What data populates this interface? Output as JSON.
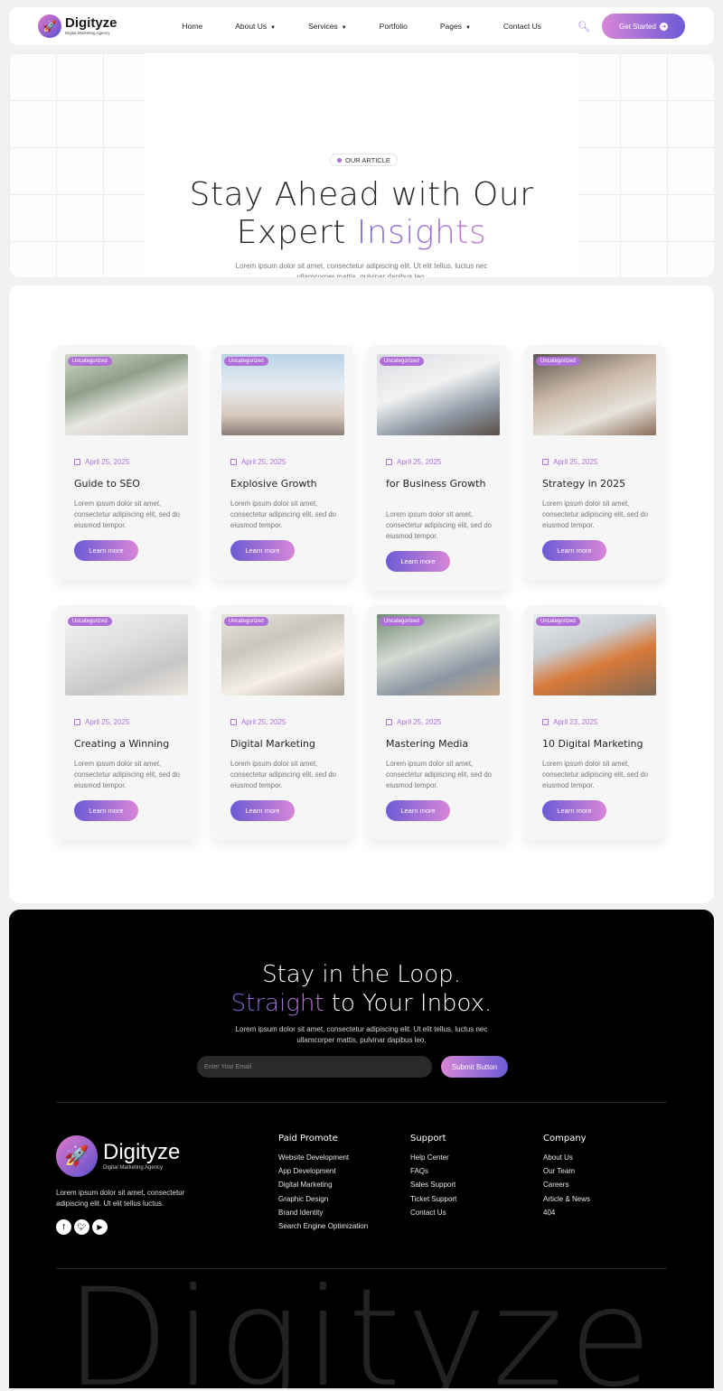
{
  "header": {
    "logo": {
      "name": "Digityze",
      "tagline": "Digital Marketing Agency"
    },
    "nav": [
      {
        "label": "Home",
        "dropdown": false
      },
      {
        "label": "About Us",
        "dropdown": true
      },
      {
        "label": "Services",
        "dropdown": true
      },
      {
        "label": "Portfolio",
        "dropdown": false
      },
      {
        "label": "Pages",
        "dropdown": true
      },
      {
        "label": "Contact Us",
        "dropdown": false
      }
    ],
    "cta_label": "Get Started"
  },
  "hero": {
    "badge": "OUR ARTICLE",
    "title_line1": "Stay Ahead with Our",
    "title_line2_plain": "Expert",
    "title_line2_accent": "Insights",
    "subtitle": "Lorem ipsum dolor sit amet, consectetur adipiscing elit. Ut elit tellus, luctus nec ullamcorper mattis, pulvinar dapibus leo."
  },
  "articles": [
    {
      "category": "Uncategorized",
      "date": "April 25, 2025",
      "title": "Guide to SEO",
      "desc": "Lorem ipsum dolor sit amet, consectetur adipiscing elit, sed do eiusmod tempor.",
      "button": "Learn more"
    },
    {
      "category": "Uncategorized",
      "date": "April 25, 2025",
      "title": "Explosive Growth",
      "desc": "Lorem ipsum dolor sit amet, consectetur adipiscing elit, sed do eiusmod tempor.",
      "button": "Learn more"
    },
    {
      "category": "Uncategorized",
      "date": "April 25, 2025",
      "title": "for Business Growth",
      "desc": "Lorem ipsum dolor sit amet, consectetur adipiscing elit, sed do eiusmod tempor.",
      "button": "Learn more"
    },
    {
      "category": "Uncategorized",
      "date": "April 25, 2025",
      "title": "Strategy in 2025",
      "desc": "Lorem ipsum dolor sit amet, consectetur adipiscing elit, sed do eiusmod tempor.",
      "button": "Learn more"
    },
    {
      "category": "Uncategorized",
      "date": "April 25, 2025",
      "title": "Creating a Winning",
      "desc": "Lorem ipsum dolor sit amet, consectetur adipiscing elit, sed do eiusmod tempor.",
      "button": "Learn more"
    },
    {
      "category": "Uncategorized",
      "date": "April 25, 2025",
      "title": "Digital Marketing",
      "desc": "Lorem ipsum dolor sit amet, consectetur adipiscing elit, sed do eiusmod tempor.",
      "button": "Learn more"
    },
    {
      "category": "Uncategorized",
      "date": "April 25, 2025",
      "title": "Mastering Media",
      "desc": "Lorem ipsum dolor sit amet, consectetur adipiscing elit, sed do eiusmod tempor.",
      "button": "Learn more"
    },
    {
      "category": "Uncategorized",
      "date": "April 23, 2025",
      "title": "10 Digital Marketing",
      "desc": "Lorem ipsum dolor sit amet, consectetur adipiscing elit, sed do eiusmod tempor.",
      "button": "Learn more"
    }
  ],
  "newsletter": {
    "title_line1": "Stay in the Loop.",
    "title_line2_accent": "Straight",
    "title_line2_plain": "to Your Inbox.",
    "subtitle": "Lorem ipsum dolor sit amet, consectetur adipiscing elit. Ut elit tellus, luctus nec ullamcorper mattis, pulvinar dapibus leo.",
    "email_placeholder": "Enter Your Email",
    "submit_label": "Submit Button"
  },
  "footer": {
    "logo": {
      "name": "Digityze",
      "tagline": "Digital Marketing Agency"
    },
    "description": "Lorem ipsum dolor sit amet, consectetur adipiscing elit. Ut elit tellus luctus.",
    "socials": [
      "facebook-icon",
      "twitter-icon",
      "youtube-icon"
    ],
    "columns": [
      {
        "heading": "Paid Promote",
        "links": [
          "Website Development",
          "App Development",
          "Digital Marketing",
          "Graphic Design",
          "Brand Identity",
          "Search Engine Optimization"
        ]
      },
      {
        "heading": "Support",
        "links": [
          "Help Center",
          "FAQs",
          "Sales Support",
          "Ticket Support",
          "Contact Us"
        ]
      },
      {
        "heading": "Company",
        "links": [
          "About Us",
          "Our Team",
          "Careers",
          "Article & News",
          "404"
        ]
      }
    ],
    "watermark": "Digityze"
  },
  "colors": {
    "accent_purple": "#b06fd8",
    "gradient_start": "#6c5bd6",
    "gradient_end": "#d886d7",
    "footer_bg": "#000000"
  }
}
